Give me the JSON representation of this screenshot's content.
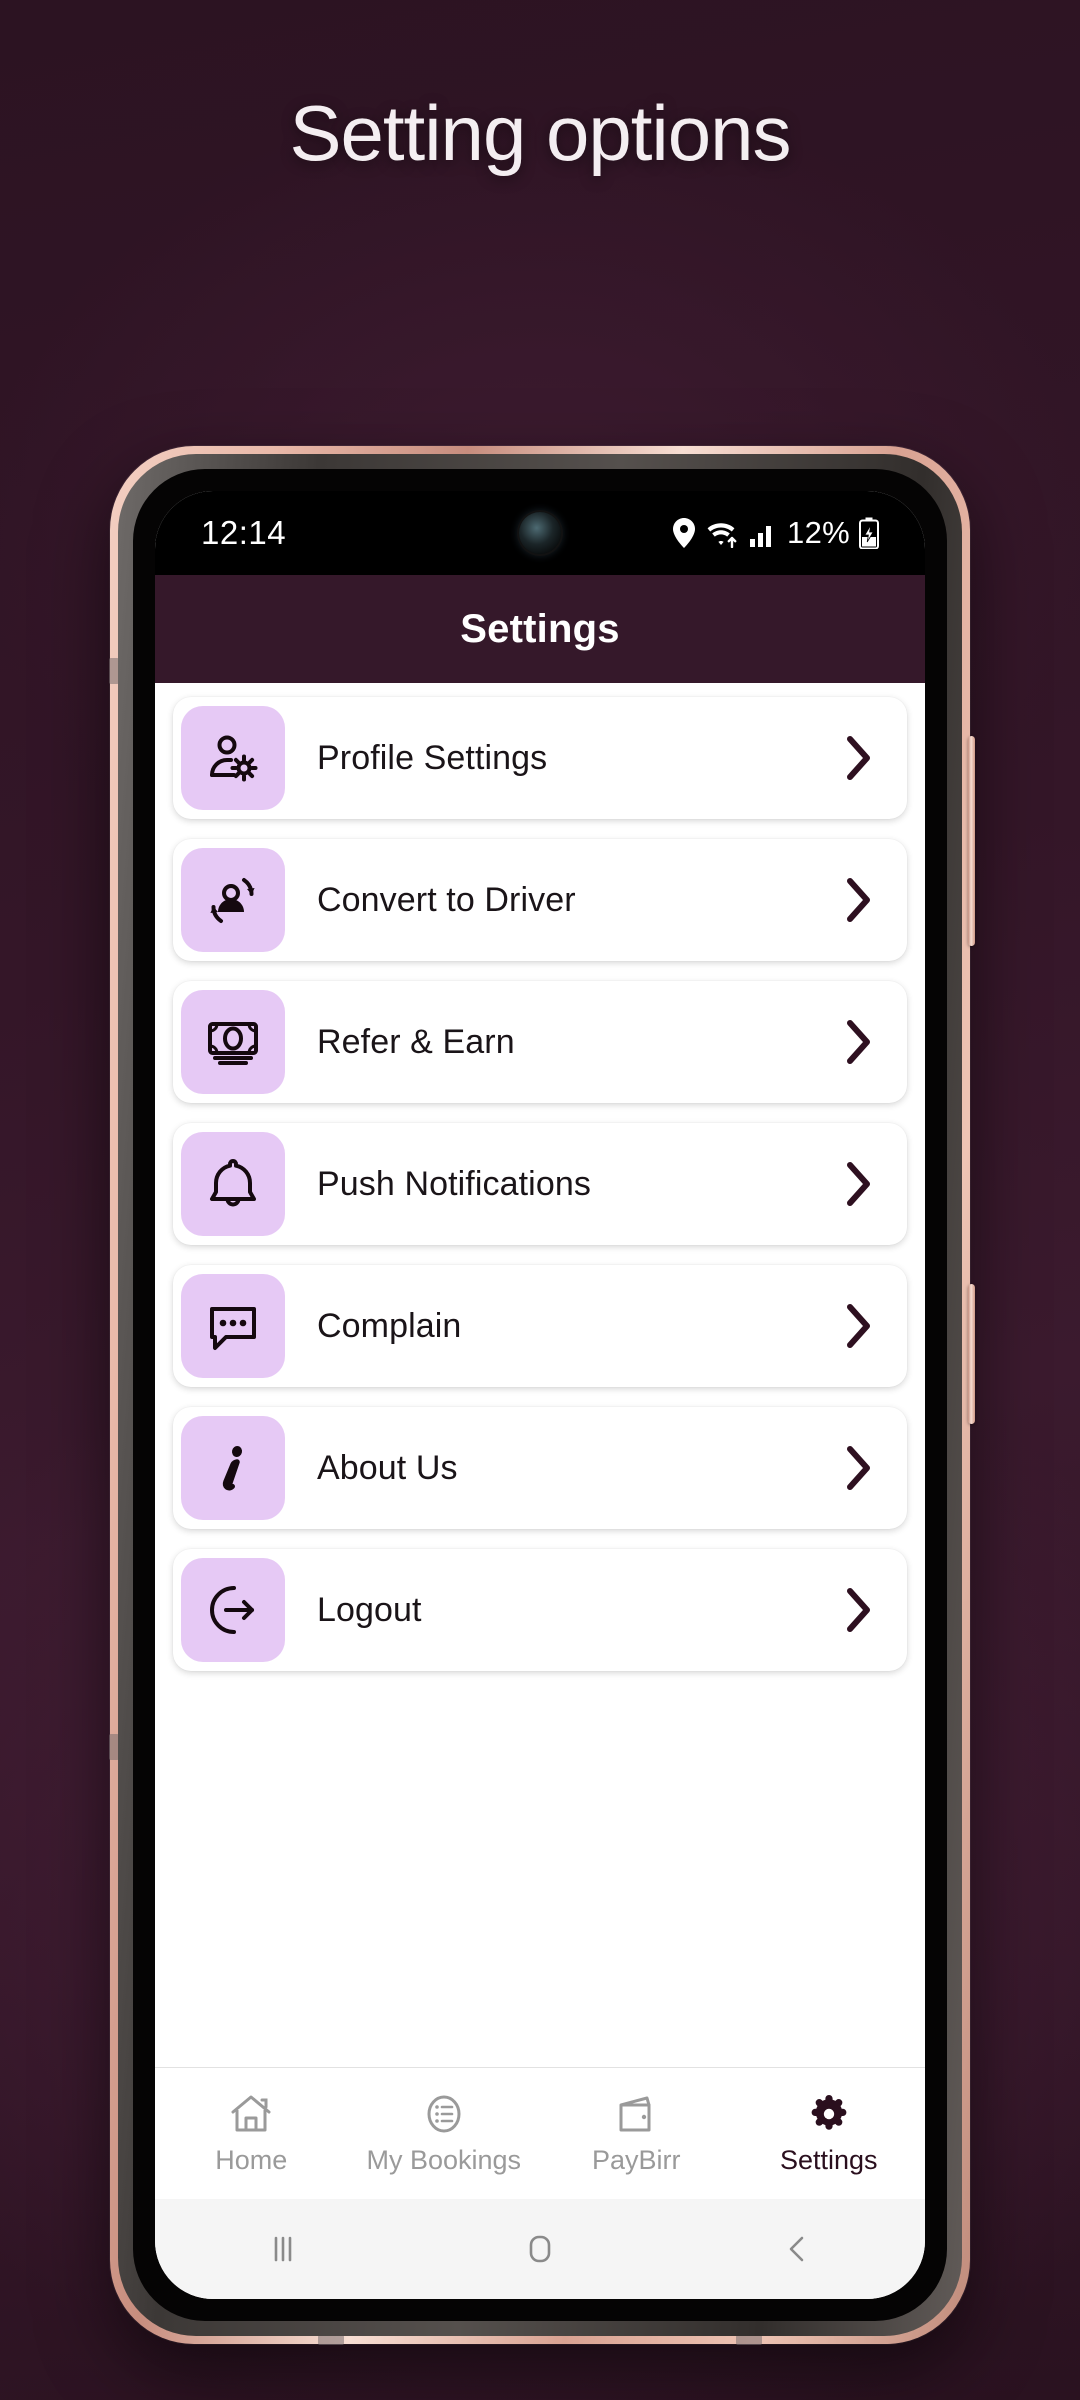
{
  "promo": {
    "headline": "Setting options"
  },
  "phone": {
    "statusbar": {
      "time": "12:14",
      "battery_percent": "12%",
      "icons": [
        "location-pin-icon",
        "wifi-icon",
        "cellular-signal-icon",
        "battery-charging-icon"
      ]
    },
    "header": {
      "title": "Settings"
    },
    "settings_list": [
      {
        "id": "profile-settings",
        "label": "Profile Settings",
        "icon": "user-gear-icon",
        "chevron": "chevron-right-icon"
      },
      {
        "id": "convert-to-driver",
        "label": "Convert to Driver",
        "icon": "user-convert-icon",
        "chevron": "chevron-right-icon"
      },
      {
        "id": "refer-and-earn",
        "label": "Refer & Earn",
        "icon": "banknote-icon",
        "chevron": "chevron-right-icon"
      },
      {
        "id": "push-notifications",
        "label": "Push Notifications",
        "icon": "bell-icon",
        "chevron": "chevron-right-icon"
      },
      {
        "id": "complain",
        "label": "Complain",
        "icon": "chat-bubble-dots-icon",
        "chevron": "chevron-right-icon"
      },
      {
        "id": "about-us",
        "label": "About Us",
        "icon": "info-italic-icon",
        "chevron": "chevron-right-icon"
      },
      {
        "id": "logout",
        "label": "Logout",
        "icon": "logout-arrow-icon",
        "chevron": "chevron-right-icon"
      }
    ],
    "bottom_nav": [
      {
        "id": "home",
        "label": "Home",
        "icon": "house-icon",
        "active": false
      },
      {
        "id": "my-bookings",
        "label": "My Bookings",
        "icon": "list-circle-icon",
        "active": false
      },
      {
        "id": "paybirr",
        "label": "PayBirr",
        "icon": "wallet-icon",
        "active": false
      },
      {
        "id": "settings",
        "label": "Settings",
        "icon": "gear-icon",
        "active": true
      }
    ],
    "system_nav": [
      {
        "id": "recents",
        "icon": "recents-bars-icon"
      },
      {
        "id": "home",
        "icon": "home-square-icon"
      },
      {
        "id": "back",
        "icon": "back-chevron-icon"
      }
    ]
  },
  "colors": {
    "page_background": "#341628",
    "app_header": "#35182a",
    "icon_tile": "#e6c9f5",
    "icon_stroke": "#1a0d14",
    "chevron": "#2e1020",
    "nav_inactive": "#9a9a9a",
    "nav_active": "#2a0f1e",
    "frame_rose_gold": "#e9b9a9",
    "promo_text": "#f4eef1"
  }
}
